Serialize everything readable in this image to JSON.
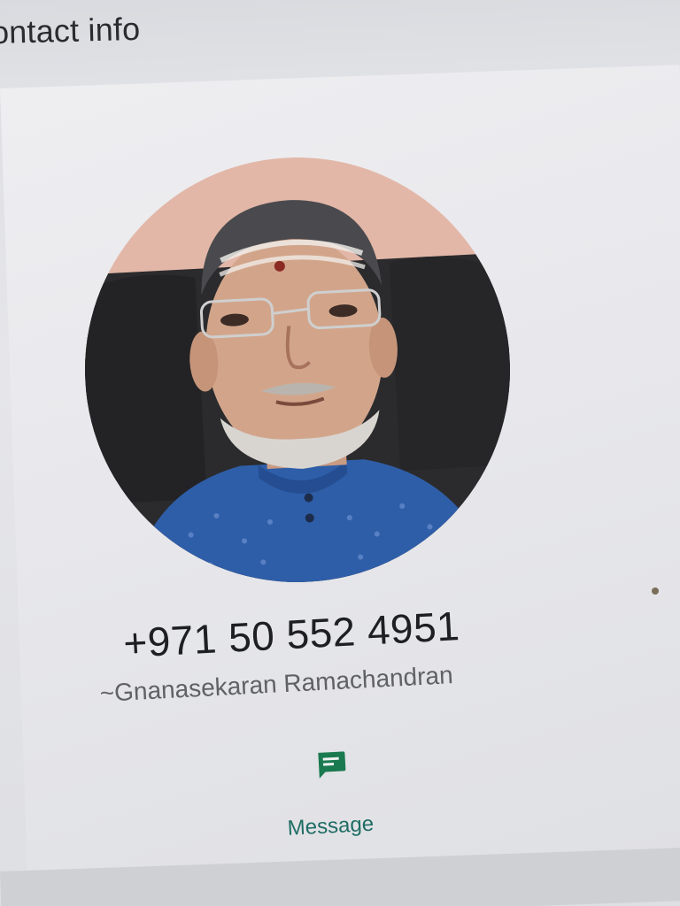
{
  "header": {
    "title": "ontact info"
  },
  "contact": {
    "phone": "+971 50 552 4951",
    "display_name": "~Gnanasekaran Ramachandran"
  },
  "actions": {
    "message_label": "Message",
    "message_icon": "message-icon"
  },
  "colors": {
    "accent": "#1f6d64",
    "icon": "#1a7a4f"
  }
}
